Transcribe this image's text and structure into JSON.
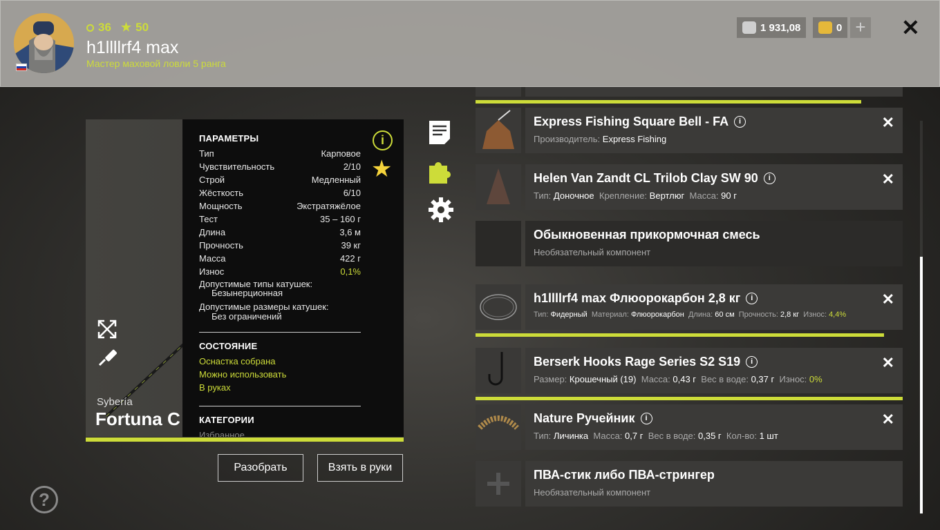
{
  "header": {
    "level": "36",
    "stars": "50",
    "player_name": "h1llllrf4 max",
    "player_title": "Мастер маховой ловли 5 ранга",
    "silver": "1 931,08",
    "gold": "0"
  },
  "rod": {
    "brand": "Sybería",
    "name": "Fortuna C",
    "title_params": "ПАРАМЕТРЫ",
    "params": [
      {
        "k": "Тип",
        "v": "Карповое"
      },
      {
        "k": "Чувствительность",
        "v": "2/10"
      },
      {
        "k": "Строй",
        "v": "Медленный"
      },
      {
        "k": "Жёсткость",
        "v": "6/10"
      },
      {
        "k": "Мощность",
        "v": "Экстратяжёлое"
      },
      {
        "k": "Тест",
        "v": "35 – 160 г"
      },
      {
        "k": "Длина",
        "v": "3,6 м"
      },
      {
        "k": "Прочность",
        "v": "39 кг"
      },
      {
        "k": "Масса",
        "v": "422 г"
      },
      {
        "k": "Износ",
        "v": "0,1%"
      }
    ],
    "reel_types_label": "Допустимые типы катушек:",
    "reel_types": "Безынерционная",
    "reel_sizes_label": "Допустимые размеры катушек:",
    "reel_sizes": "Без ограничений",
    "title_state": "СОСТОЯНИЕ",
    "state": [
      "Оснастка собрана",
      "Можно использовать",
      "В руках"
    ],
    "title_cat": "КАТЕГОРИИ",
    "cat_first": "Избранное"
  },
  "buttons": {
    "disassemble": "Разобрать",
    "take": "Взять в руки"
  },
  "items": [
    {
      "name": "Express Fishing Square Bell - FA",
      "desc": [
        [
          "Производитель:",
          "Express Fishing"
        ]
      ]
    },
    {
      "name": "Helen Van Zandt CL Trilob Clay SW 90",
      "desc": [
        [
          "Тип:",
          "Доночное"
        ],
        [
          "Крепление:",
          "Вертлюг"
        ],
        [
          "Масса:",
          "90 г"
        ]
      ]
    },
    {
      "name": "Обыкновенная прикормочная смесь",
      "plain": "Необязательный компонент"
    },
    {
      "name": "h1llllrf4 max Флюорокарбон 2,8 кг",
      "desc": [
        [
          "Тип:",
          "Фидерный"
        ],
        [
          "Материал:",
          "Флюорокарбон"
        ],
        [
          "Длина:",
          "60 см"
        ],
        [
          "Прочность:",
          "2,8 кг"
        ],
        [
          "Износ:",
          "4,4%"
        ]
      ]
    },
    {
      "name": "Berserk Hooks Rage Series S2 S19",
      "desc": [
        [
          "Размер:",
          "Крошечный (19)"
        ],
        [
          "Масса:",
          "0,43 г"
        ],
        [
          "Вес в воде:",
          "0,37 г"
        ],
        [
          "Износ:",
          "0%"
        ]
      ]
    },
    {
      "name": "Nature Ручейник",
      "desc": [
        [
          "Тип:",
          "Личинка"
        ],
        [
          "Масса:",
          "0,7 г"
        ],
        [
          "Вес в воде:",
          "0,35 г"
        ],
        [
          "Кол-во:",
          "1 шт"
        ]
      ]
    },
    {
      "name": "ПВА-стик либо ПВА-стрингер",
      "plain": "Необязательный компонент"
    }
  ]
}
